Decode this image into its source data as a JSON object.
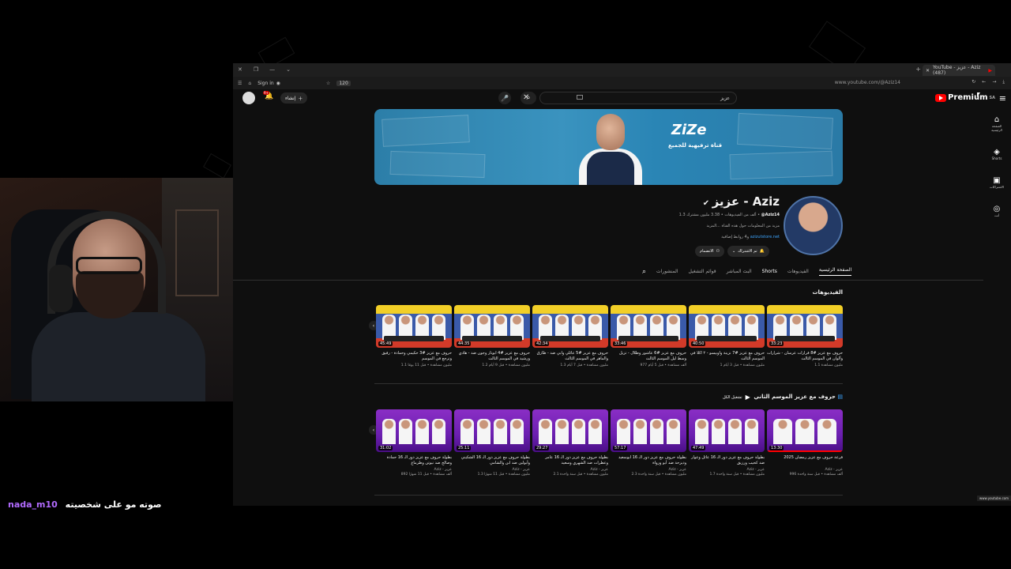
{
  "stream": {
    "chat_user": "nada_m10",
    "chat_message": "صوته مو على شخصيته"
  },
  "browser": {
    "tab_title": "YouTube - عزيز - Aziz (487)",
    "sign_in": "Sign in",
    "extension_badge": "120",
    "url": "www.youtube.com/@Aziz14",
    "status_url": "www.youtube.com"
  },
  "header": {
    "logo_text": "Premium",
    "logo_region": "SA",
    "search_value": "عزيز",
    "create_label": "إنشاء",
    "notif_count": "9+"
  },
  "rail": {
    "items": [
      {
        "label": "الصفحة الرئيسية",
        "icon": "home-icon"
      },
      {
        "label": "Shorts",
        "icon": "shorts-icon"
      },
      {
        "label": "الاشتراكات",
        "icon": "subscriptions-icon"
      },
      {
        "label": "أنت",
        "icon": "you-icon"
      }
    ]
  },
  "banner": {
    "brand": "ZiZe",
    "tagline": "قناة ترفيهية للجميع"
  },
  "channel": {
    "name": "عزيز - Aziz",
    "handle": "@Aziz14",
    "subs": "3.38 مليون مشترك",
    "videos": "1.3 ألف من الفيديوهات",
    "desc": "مزيد من المعلومات حول هذه القناة ...المزيد",
    "link": "azizutstore.net",
    "link_more": "و4 روابط إضافية",
    "subscribed_label": "تم الاشتراك",
    "join_label": "الانضمام"
  },
  "tabs": [
    "الصفحة الرئيسية",
    "الفيديوهات",
    "Shorts",
    "البث المباشر",
    "قوائم التشغيل",
    "المنشورات"
  ],
  "shelf1": {
    "title": "الفيديوهات",
    "videos": [
      {
        "title": "حروف مع عزيز #8 قرارات عرسان - شرارات وألوان في الموسم الثالث",
        "meta": "1.1 مليون مشاهدة",
        "dur": "33:23"
      },
      {
        "title": "حروف مع عزيز #7 نزينة وأوبيسو - ٢ أكلا في الموسم الثالث",
        "meta": "1 مليون مشاهدة • قبل 3 أيام",
        "dur": "40:50"
      },
      {
        "title": "حروف مع عزيز #6 عاشور وطلال - تزيل وسط ليل الموسم الثالث",
        "meta": "977 ألف مشاهدة • قبل 5 أيام",
        "dur": "33:46"
      },
      {
        "title": "حروف مع عزيز #5 عائلي وابي ضد - طارق والماهر في الموسم الثالث",
        "meta": "1.3 مليون مشاهدة • قبل 7 أيام",
        "dur": "42:34"
      },
      {
        "title": "حروف مع عزيز #4 أبونار وجون ضد - هادي ورشيد في الموسم الثالث",
        "meta": "1.2 مليون مشاهدة • قبل 9 أيام",
        "dur": "44:35"
      },
      {
        "title": "حروف مع عزيز #3 حكيمي وحمادة - رفيق ونرجع في الموسم",
        "meta": "1.1 مليون مشاهدة • قبل 11 يومًا",
        "dur": "45:49"
      }
    ]
  },
  "shelf2": {
    "title": "حروف مع عزيز الموسم الثاني",
    "play_all": "تشغيل الكل",
    "videos": [
      {
        "title": "فرعة حروف مع عزيز رمضان 2025",
        "meta": "Aziz - عزيز\n996 ألف مشاهدة • قبل سنة واحدة",
        "dur": "13:30"
      },
      {
        "title": "بطولة حروف مع عزيز دور الـ 16 عائل وعوار ضد كحيب ورزيق",
        "meta": "Aziz - عزيز\n1.7 مليون مشاهدة • قبل سنة واحدة",
        "dur": "47:49"
      },
      {
        "title": "بطولة حروف مع عزيز دور الـ 16 أبوسعيد وديزحة ضد أبو ورواة",
        "meta": "Aziz - عزيز\n2.3 مليون مشاهدة • قبل سنة واحدة",
        "dur": "57:17"
      },
      {
        "title": "بطولة حروف مع عزيز دور الـ 16 عامر وعطرات ضد الشهري وسعيد",
        "meta": "Aziz - عزيز\n2.1 مليون مشاهدة • قبل سنة واحدة",
        "dur": "29:27"
      },
      {
        "title": "بطولة حروف مع عزيز دور الـ 16 الشكيني وأبولين ضد ابن والشامي",
        "meta": "Aziz - عزيز\n1.3 مليون مشاهدة • قبل 11 شهرًا",
        "dur": "25:11"
      },
      {
        "title": "بطولة حروف مع عزيز دور الـ 16 حمادة وصالح ضد نيوتن وطزماع",
        "meta": "Aziz - عزيز\n892 ألف مشاهدة • قبل 11 شهرًا",
        "dur": "31:02"
      }
    ]
  }
}
